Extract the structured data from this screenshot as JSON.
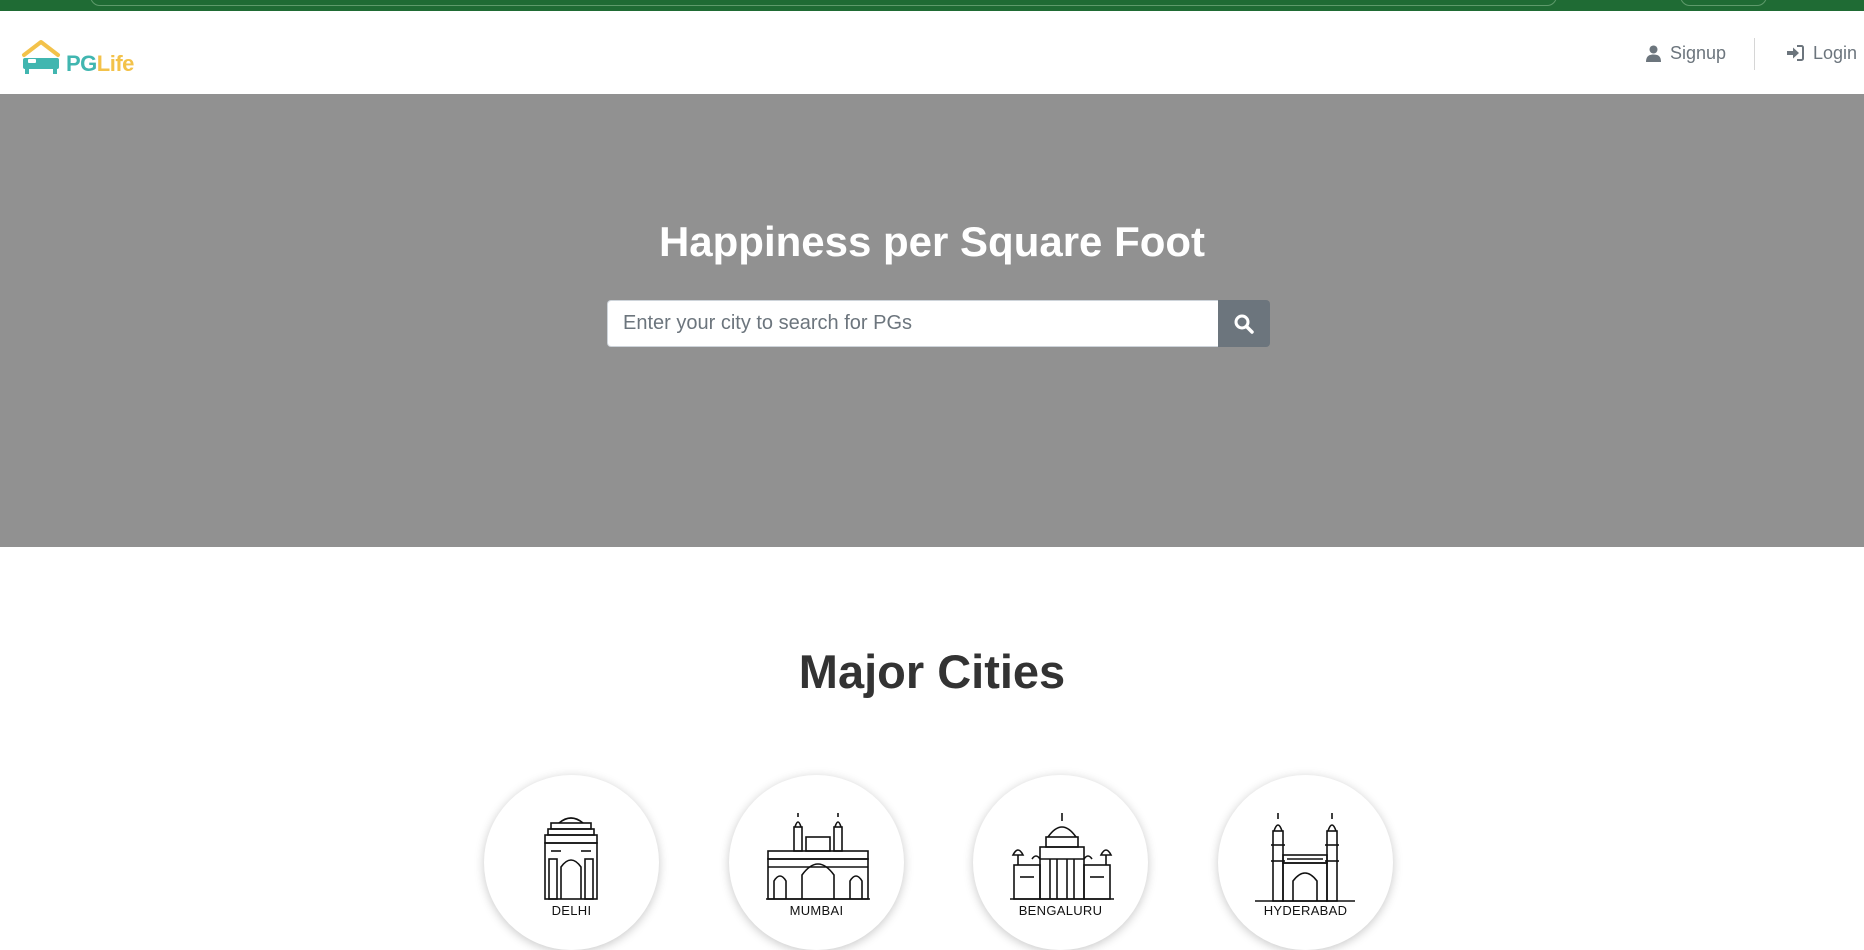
{
  "brand": {
    "part1": "PG",
    "part2": "Life",
    "colors": {
      "teal": "#41b6b0",
      "yellow": "#f3c24a"
    },
    "icon": "house-bed-logo-icon"
  },
  "nav": {
    "signup_label": "Signup",
    "signup_icon": "user-icon",
    "login_label": "Login",
    "login_icon": "sign-in-icon"
  },
  "hero": {
    "title": "Happiness per Square Foot",
    "search_placeholder": "Enter your city to search for PGs",
    "search_value": "",
    "search_icon": "search-icon",
    "background": "#919191"
  },
  "cities_section": {
    "title": "Major Cities",
    "cities": [
      {
        "name": "DELHI",
        "icon": "india-gate-icon"
      },
      {
        "name": "MUMBAI",
        "icon": "gateway-of-india-icon"
      },
      {
        "name": "BENGALURU",
        "icon": "vidhana-soudha-icon"
      },
      {
        "name": "HYDERABAD",
        "icon": "charminar-icon"
      }
    ]
  }
}
